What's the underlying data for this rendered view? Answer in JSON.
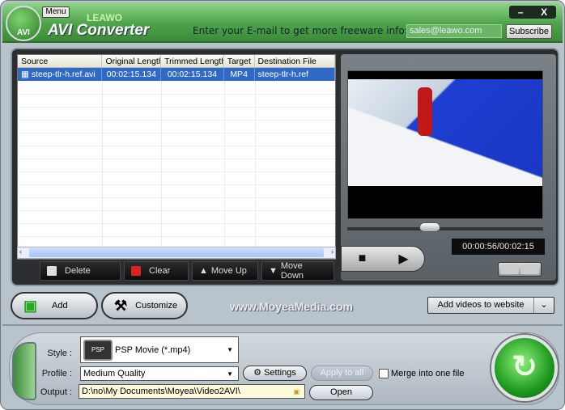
{
  "header": {
    "menu": "Menu",
    "brand": "LEAWO",
    "title": "AVI Converter",
    "logo_text": "AVI",
    "email_prompt": "Enter your E-mail to get more freeware info:",
    "email_value": "sales@leawo.com",
    "subscribe": "Subscribe",
    "minimize": "–",
    "close": "X"
  },
  "list": {
    "columns": [
      "Source",
      "Original Length",
      "Trimmed Length",
      "Target",
      "Destination File"
    ],
    "rows": [
      {
        "source": "steep-tlr-h.ref.avi",
        "original": "00:02:15.134",
        "trimmed": "00:02:15.134",
        "target": "MP4",
        "destination": "steep-tlr-h.ref"
      }
    ],
    "buttons": {
      "delete": "Delete",
      "clear": "Clear",
      "move_up": "Move Up",
      "move_down": "Move Down"
    }
  },
  "player": {
    "time": "00:00:56/00:02:15",
    "progress": 0.41
  },
  "actions": {
    "add": "Add",
    "customize": "Customize",
    "website": "www.MoyeaMedia.com",
    "add_videos": "Add videos to website"
  },
  "output": {
    "style_label": "Style :",
    "style_value": "PSP Movie (*.mp4)",
    "style_icon_text": "PSP",
    "profile_label": "Profile :",
    "profile_value": "Medium Quality",
    "output_label": "Output :",
    "output_value": "D:\\no\\My Documents\\Moyea\\Video2AVI\\",
    "settings": "Settings",
    "apply_all": "Apply to all",
    "merge": "Merge into one file",
    "merge_checked": false,
    "open": "Open"
  }
}
